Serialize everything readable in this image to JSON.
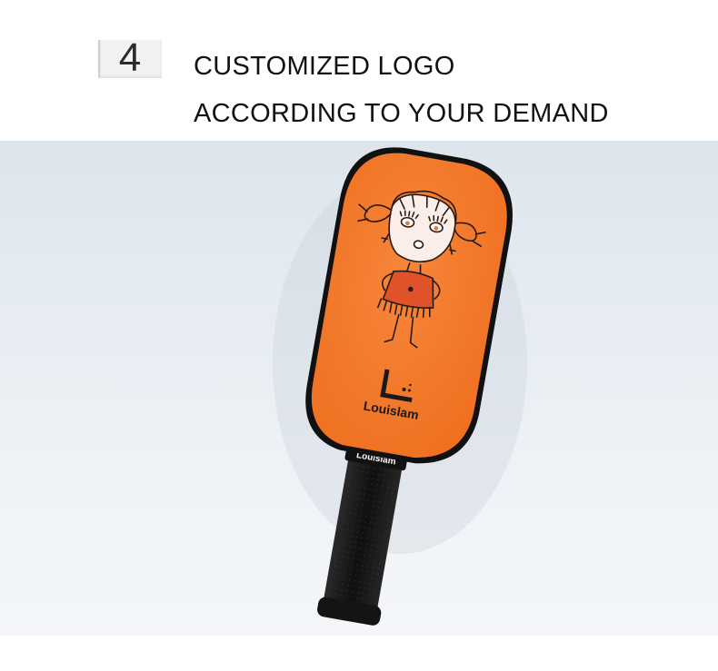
{
  "step": {
    "number": "4"
  },
  "headline": {
    "line1": "CUSTOMIZED LOGO",
    "line2": "ACCORDING TO YOUR DEMAND"
  },
  "paddle": {
    "brand_logo_text": "Louislam",
    "handle_band_text": "Louislam",
    "face_color": "#f47b2a",
    "edge_color": "#111111",
    "grip_color": "#1a1a1a"
  }
}
